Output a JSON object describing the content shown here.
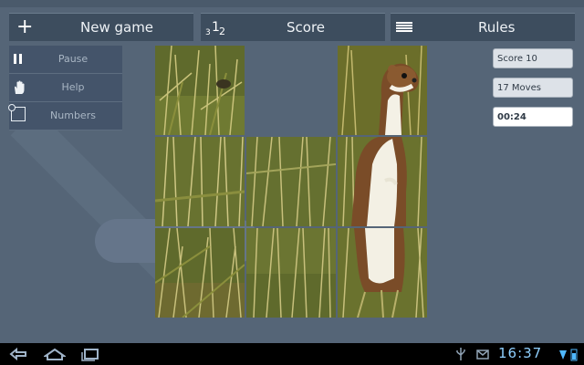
{
  "toolbar": {
    "new_game_label": "New game",
    "new_game_icon": "plus-icon",
    "score_label": "Score",
    "score_icon": "numbers-order-icon",
    "score_icon_text": "312",
    "rules_label": "Rules",
    "rules_icon": "list-lines-icon"
  },
  "menu": {
    "pause_label": "Pause",
    "help_label": "Help",
    "numbers_label": "Numbers"
  },
  "status": {
    "score": "Score 10",
    "moves": "17 Moves",
    "time": "00:24"
  },
  "puzzle": {
    "grid": "3x3",
    "empty_tile": "row 1, column 2",
    "image_subject": "stoat standing in grass"
  },
  "system_bar": {
    "clock": "16:37"
  },
  "colors": {
    "background": "#556577",
    "button": "#3d4d5e",
    "menu": "#44546a",
    "clock": "#8fd0ff"
  }
}
